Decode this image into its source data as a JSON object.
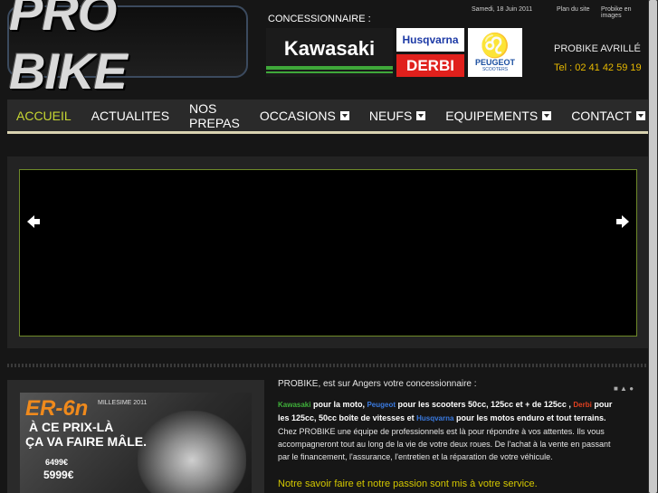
{
  "header": {
    "logo_text": "PRO BIKE",
    "date": "Samedi, 18 Juin 2011",
    "link_plan": "Plan du site",
    "link_images": "Probike en images",
    "concessionnaire_label": "CONCESSIONNAIRE :",
    "brands": {
      "kawasaki": "Kawasaki",
      "husqvarna": "Husqvarna",
      "derbi": "DERBI",
      "peugeot": "PEUGEOT",
      "peugeot_sub": "SCOOTERS"
    },
    "shop_name": "PROBIKE AVRILLÉ",
    "phone": "Tel : 02 41 42 59 19"
  },
  "nav": {
    "items": [
      {
        "label": "ACCUEIL",
        "dropdown": false,
        "active": true
      },
      {
        "label": "ACTUALITES",
        "dropdown": false,
        "active": false
      },
      {
        "label": "NOS PREPAS",
        "dropdown": false,
        "active": false
      },
      {
        "label": "OCCASIONS",
        "dropdown": true,
        "active": false
      },
      {
        "label": "NEUFS",
        "dropdown": true,
        "active": false
      },
      {
        "label": "EQUIPEMENTS",
        "dropdown": true,
        "active": false
      },
      {
        "label": "CONTACT",
        "dropdown": true,
        "active": false
      }
    ]
  },
  "slider": {
    "prev_icon": "arrow-left-icon",
    "next_icon": "arrow-right-icon"
  },
  "promo": {
    "title": "ER-6n",
    "millesime": "MILLESIME 2011",
    "line1": "À CE PRIX-LÀ",
    "line2": "ÇA VA FAIRE MÂLE.",
    "price1": "6499€",
    "price2": "5999€"
  },
  "content": {
    "intro": "PROBIKE, est sur Angers votre concessionnaire :",
    "kawasaki": "Kawasaki",
    "t1": " pour la moto, ",
    "peugeot": "Peugeot",
    "t2": " pour les scooters 50cc, 125cc et + de 125cc , ",
    "derbi": "Derbi",
    "t3": " pour les 125cc, 50cc boîte de vitesses et ",
    "husqvarna": "Husqvarna",
    "t4": " pour les motos enduro et tout terrains.",
    "paragraph": "Chez PROBIKE une équipe de professionnels est là pour répondre à vos attentes. Ils vous accompagneront tout au long de la vie de votre deux roues. De l'achat à la vente en passant par le financement, l'assurance, l'entretien et la réparation de votre véhicule.",
    "slogan": "Notre savoir faire et notre passion sont mis à votre service."
  },
  "colors": {
    "active_nav": "#c6d632",
    "phone": "#e6b800",
    "slogan": "#d4c800"
  }
}
